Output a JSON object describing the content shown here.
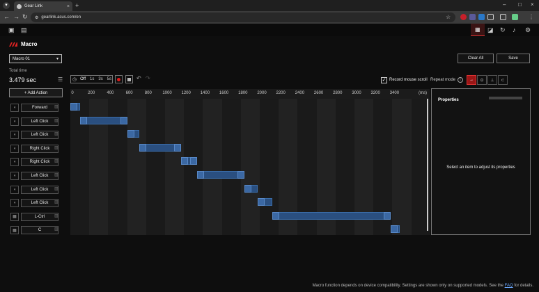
{
  "browser": {
    "tab_title": "Gear Link",
    "url": "gearlink.asus.com/en"
  },
  "app": {
    "title": "Macro",
    "macro_select": "Macro 01",
    "clear_all": "Clear All",
    "save": "Save",
    "total_time_label": "Total time",
    "total_time_value": "3.479 sec",
    "delay_options": [
      "Off",
      "1s",
      "3s",
      "5s"
    ],
    "record_mouse_scroll": "Record mouse scroll",
    "repeat_mode_label": "Repeat mode",
    "add_action": "+ Add Action",
    "actions": [
      {
        "icon": "mouse-icon",
        "label": "Forward"
      },
      {
        "icon": "mouse-icon",
        "label": "Left Click"
      },
      {
        "icon": "mouse-icon",
        "label": "Left Click"
      },
      {
        "icon": "mouse-icon",
        "label": "Right Click"
      },
      {
        "icon": "mouse-icon",
        "label": "Right Click"
      },
      {
        "icon": "mouse-icon",
        "label": "Left Click"
      },
      {
        "icon": "mouse-icon",
        "label": "Left Click"
      },
      {
        "icon": "mouse-icon",
        "label": "Left Click"
      },
      {
        "icon": "keyboard-icon",
        "label": "L-Ctrl"
      },
      {
        "icon": "keyboard-icon",
        "label": "C"
      }
    ],
    "timeline": {
      "ticks": [
        "0",
        "200",
        "400",
        "600",
        "800",
        "1000",
        "1200",
        "1400",
        "1600",
        "1800",
        "2000",
        "2200",
        "2400",
        "2600",
        "2800",
        "3000",
        "3200",
        "3400"
      ],
      "unit": "(ms)",
      "events": [
        {
          "start": 0,
          "end": 100
        },
        {
          "start": 100,
          "end": 600
        },
        {
          "start": 600,
          "end": 730
        },
        {
          "start": 730,
          "end": 1170
        },
        {
          "start": 1170,
          "end": 1340
        },
        {
          "start": 1340,
          "end": 1840
        },
        {
          "start": 1840,
          "end": 1980
        },
        {
          "start": 1980,
          "end": 2130
        },
        {
          "start": 2130,
          "end": 3380
        },
        {
          "start": 3380,
          "end": 3479
        }
      ]
    },
    "properties_title": "Properties",
    "properties_empty": "Select an item to adjust its properties"
  },
  "footer": {
    "text": "Macro function depends on device compatibility. Settings are shown only on supported models. See the",
    "link": "FAQ",
    "tail": "for details."
  }
}
